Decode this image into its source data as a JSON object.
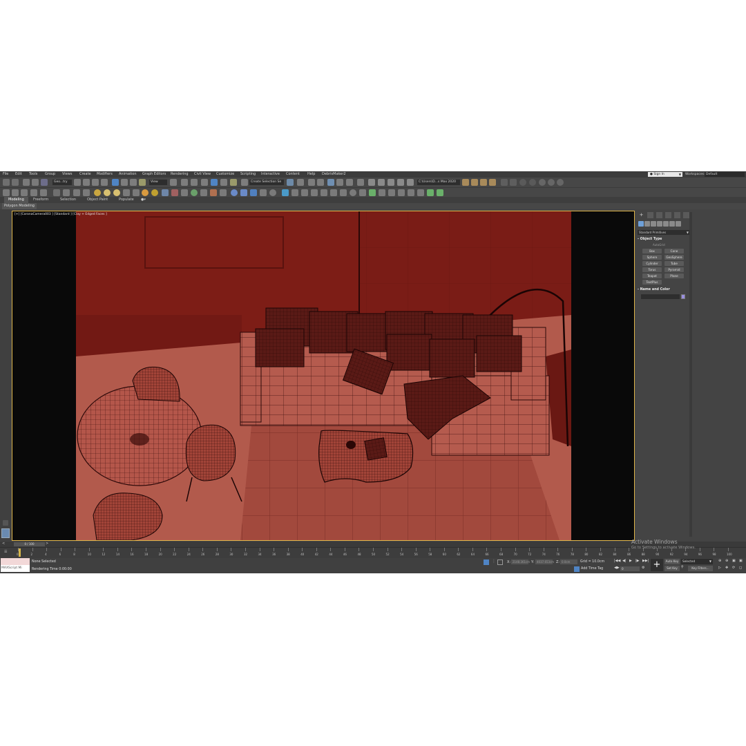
{
  "menu": [
    "File",
    "Edit",
    "Tools",
    "Group",
    "Views",
    "Create",
    "Modifiers",
    "Animation",
    "Graph Editors",
    "Rendering",
    "Civil View",
    "Customize",
    "Scripting",
    "Interactive",
    "Content",
    "Help",
    "DebrisMaker2"
  ],
  "header": {
    "sign_in": "Sign In",
    "workspaces_label": "Workspaces:",
    "workspace_value": "Default"
  },
  "toolbar": {
    "selection_filter": "Geo...try",
    "reference_coord": "View",
    "selection_set": "Create Selection Se",
    "project_path": "C:\\Users\\D...s Max 2020"
  },
  "ribbon": {
    "tabs": [
      "Modeling",
      "Freeform",
      "Selection",
      "Object Paint",
      "Populate"
    ],
    "panel_label": "Polygon Modeling"
  },
  "viewport": {
    "label": "[+] [CoronaCamera003 ] [Standard ] [Clay + Edged Faces ]"
  },
  "command_panel": {
    "category": "Standard Primitives",
    "object_type_title": "Object Type",
    "autogrid": "AutoGrid",
    "primitives": [
      "Box",
      "Cone",
      "Sphere",
      "GeoSphere",
      "Cylinder",
      "Tube",
      "Torus",
      "Pyramid",
      "Teapot",
      "Plane",
      "TextPlus"
    ],
    "name_color_title": "Name and Color",
    "color": "#9a8fe0"
  },
  "timeline": {
    "frame_display": "0 / 100",
    "ticks": [
      "0",
      "2",
      "4",
      "6",
      "8",
      "10",
      "12",
      "14",
      "16",
      "18",
      "20",
      "22",
      "24",
      "26",
      "28",
      "30",
      "32",
      "34",
      "36",
      "38",
      "40",
      "42",
      "44",
      "46",
      "48",
      "50",
      "52",
      "54",
      "56",
      "58",
      "60",
      "62",
      "64",
      "66",
      "68",
      "70",
      "72",
      "74",
      "76",
      "78",
      "80",
      "82",
      "84",
      "86",
      "88",
      "90",
      "92",
      "94",
      "96",
      "98",
      "100"
    ]
  },
  "status": {
    "maxscript_label": "MAXScript Mi",
    "selection": "None Selected",
    "render_time": "Rendering Time  0:00:00",
    "x_label": "X:",
    "y_label": "Y:",
    "z_label": "Z:",
    "x_value": "2148.361cm",
    "y_value": "4037.653cm",
    "z_value": "0.0cm",
    "grid": "Grid = 10.0cm",
    "add_time_tag": "Add Time Tag",
    "current_frame": "0",
    "auto_key": "Auto Key",
    "set_key": "Set Key",
    "selected": "Selected",
    "key_filters": "Key Filters..."
  },
  "watermark": {
    "title": "Activate Windows",
    "subtitle": "Go to Settings to activate Windows."
  }
}
